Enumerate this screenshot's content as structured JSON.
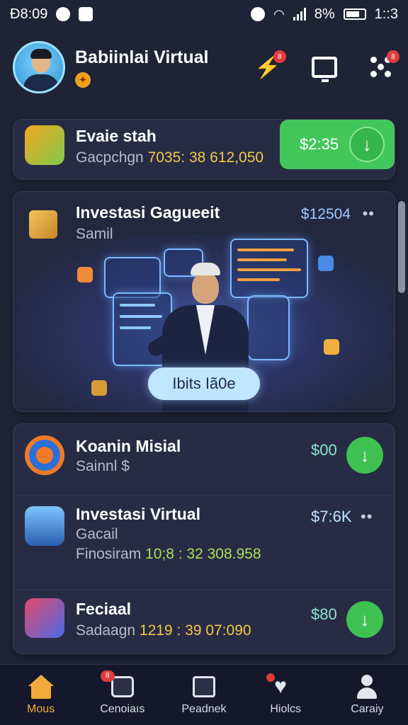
{
  "status_bar": {
    "time": "Ð8:09",
    "battery": "8%",
    "right_time": "1::3"
  },
  "header": {
    "title": "Babiinlai Virtual",
    "bolt_badge": "8",
    "dots_badge": "8"
  },
  "top_item": {
    "title": "Evaie stah",
    "subtitle_prefix": "Gacpchgn ",
    "subtitle_number": "7035: 38 612,050",
    "price": "$2:35"
  },
  "hero": {
    "title": "Investasi Gagueeit",
    "subtitle": "Samil",
    "price": "$12504",
    "button": "Ibits Iã0e"
  },
  "list": [
    {
      "title": "Koanin Misial",
      "subtitle": "Sainnl $",
      "price": "$00"
    },
    {
      "title": "Investasi Virtual",
      "subtitle": "Gacail",
      "line3_prefix": "Finosiram ",
      "line3_number": "10;8 : 32 308.958",
      "price": "$7:6K"
    },
    {
      "title": "Feciaal",
      "subtitle_prefix": "Sadaagn ",
      "subtitle_number": "1219 : 39 07:090",
      "price": "$80"
    }
  ],
  "nav": [
    {
      "label": "Mous",
      "icon": "home-icon",
      "active": true
    },
    {
      "label": "Cenoiaıs",
      "icon": "wallet-icon",
      "badge": "8"
    },
    {
      "label": "Peadnek",
      "icon": "tools-icon"
    },
    {
      "label": "Hiolcs",
      "icon": "heart-icon"
    },
    {
      "label": "Caraiy",
      "icon": "user-icon"
    }
  ],
  "colors": {
    "background": "#1f2336",
    "accent_green": "#44c75a",
    "nav_active": "#f2a93b",
    "price_teal": "#8fe2d2",
    "number_gold": "#f3c846"
  }
}
